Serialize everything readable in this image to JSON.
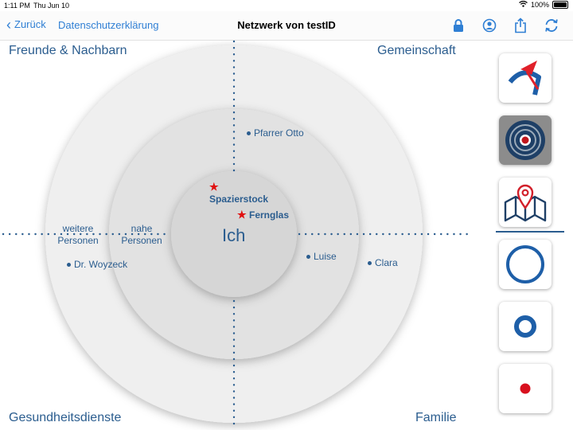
{
  "status": {
    "time": "1:11 PM",
    "date": "Thu Jun 10",
    "battery": "100%"
  },
  "nav": {
    "back_label": "Zurück",
    "privacy_label": "Datenschutzerklärung",
    "title": "Netzwerk von testID",
    "icons": [
      "lock-icon",
      "user-circle-icon",
      "share-icon",
      "refresh-icon"
    ]
  },
  "quadrants": {
    "top_left": "Freunde & Nachbarn",
    "top_right": "Gemeinschaft",
    "bottom_left": "Gesundheitsdienste",
    "bottom_right": "Familie"
  },
  "center_label": "Ich",
  "rings": {
    "outer": "weitere Personen",
    "inner": "nahe Personen",
    "outer_line1": "weitere",
    "outer_line2": "Personen",
    "inner_line1": "nahe",
    "inner_line2": "Personen"
  },
  "items": {
    "spazierstock": "Spazierstock",
    "fernglas": "Fernglas"
  },
  "people": {
    "pfarrer": "Pfarrer Otto",
    "luise": "Luise",
    "clara": "Clara",
    "woyzeck": "Dr. Woyzeck"
  },
  "colors": {
    "accent": "#2f7fd4",
    "label": "#2b5d8f",
    "star": "#e01010",
    "active_tab": "#8c8c8c"
  },
  "sidebar": {
    "buttons": [
      "logo-icon",
      "target-icon",
      "map-pin-icon",
      "large-ring-icon",
      "medium-ring-icon",
      "small-dot-icon"
    ],
    "active": "target-icon"
  }
}
